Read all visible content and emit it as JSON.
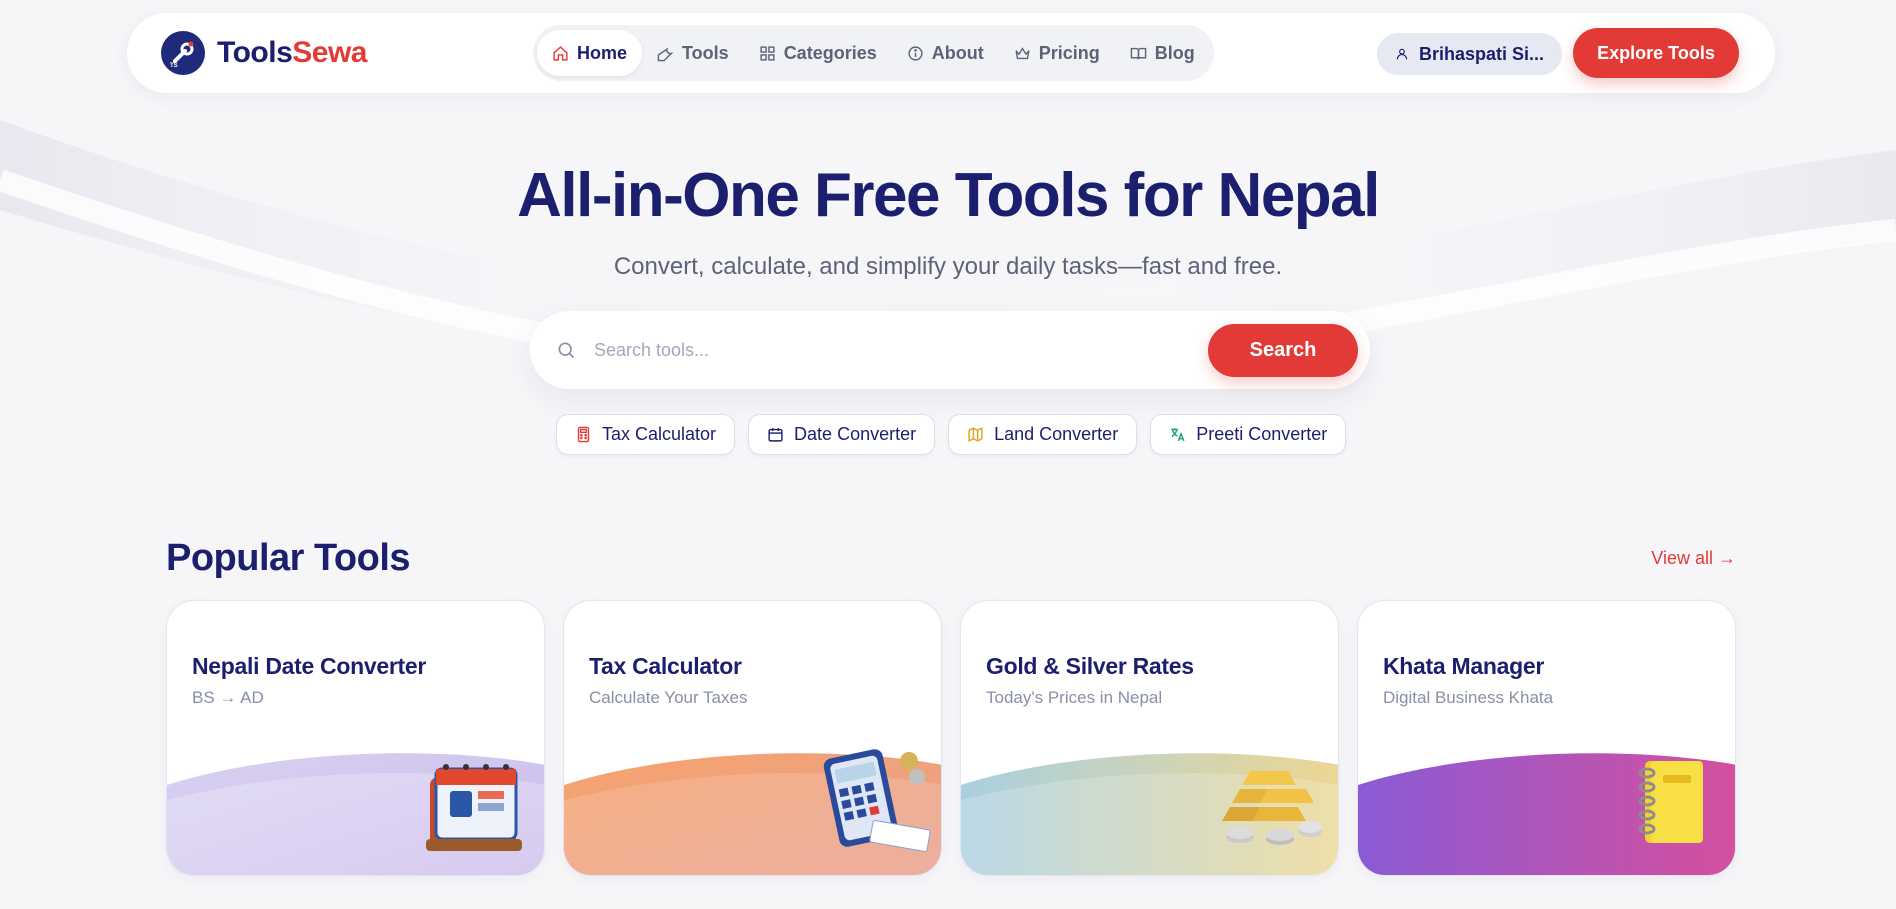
{
  "brand": {
    "part1": "Tools",
    "part2": "Sewa",
    "logo_small_text": "TS"
  },
  "nav": {
    "items": [
      {
        "label": "Home",
        "icon": "home-icon",
        "active": true
      },
      {
        "label": "Tools",
        "icon": "wrench-icon",
        "active": false
      },
      {
        "label": "Categories",
        "icon": "grid-icon",
        "active": false
      },
      {
        "label": "About",
        "icon": "info-icon",
        "active": false
      },
      {
        "label": "Pricing",
        "icon": "crown-icon",
        "active": false
      },
      {
        "label": "Blog",
        "icon": "book-icon",
        "active": false
      }
    ],
    "user_name": "Brihaspati Si...",
    "explore_label": "Explore Tools"
  },
  "hero": {
    "title": "All-in-One Free Tools for Nepal",
    "subtitle": "Convert, calculate, and simplify your daily tasks—fast and free.",
    "search_placeholder": "Search tools...",
    "search_label": "Search",
    "tags": [
      {
        "label": "Tax Calculator",
        "icon": "calculator-icon",
        "color": "#e23a36"
      },
      {
        "label": "Date Converter",
        "icon": "calendar-icon",
        "color": "#1b1f6e"
      },
      {
        "label": "Land Converter",
        "icon": "map-icon",
        "color": "#e0a21b"
      },
      {
        "label": "Preeti Converter",
        "icon": "translate-icon",
        "color": "#1aa37a"
      }
    ]
  },
  "popular": {
    "title": "Popular Tools",
    "view_all": "View all →",
    "cards": [
      {
        "title": "Nepali Date Converter",
        "subtitle": "BS → AD",
        "illustration": "calendar-illustration"
      },
      {
        "title": "Tax Calculator",
        "subtitle": "Calculate Your Taxes",
        "illustration": "calculator-illustration"
      },
      {
        "title": "Gold & Silver Rates",
        "subtitle": "Today's Prices in Nepal",
        "illustration": "gold-bars-illustration"
      },
      {
        "title": "Khata Manager",
        "subtitle": "Digital Business Khata",
        "illustration": "notebook-illustration"
      }
    ]
  },
  "colors": {
    "navy": "#1b1f6e",
    "accent_red": "#e23a36",
    "muted": "#5d6279"
  }
}
